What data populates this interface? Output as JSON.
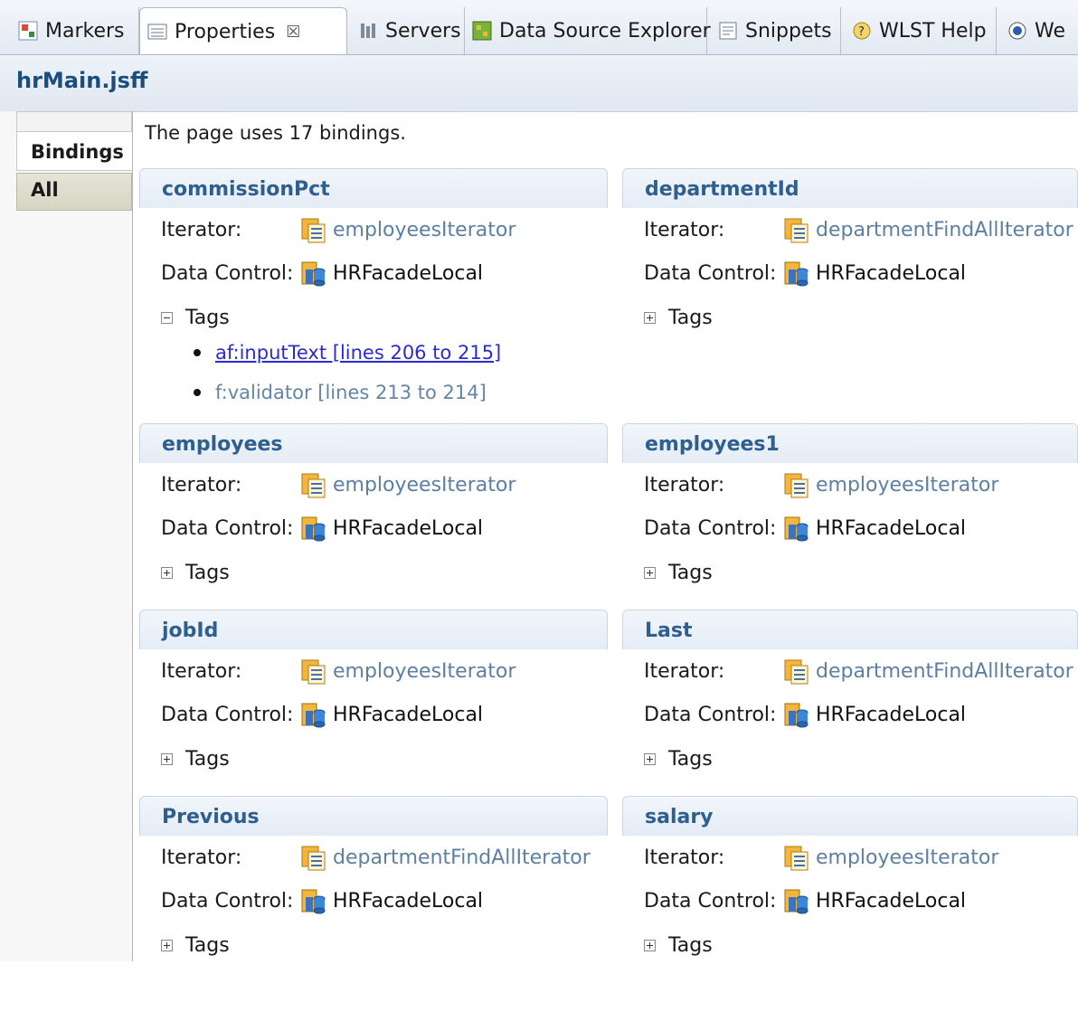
{
  "tabs": [
    {
      "label": "Markers",
      "icon": "markers-icon",
      "active": false
    },
    {
      "label": "Properties",
      "icon": "properties-icon",
      "active": true,
      "close": "☒"
    },
    {
      "label": "Servers",
      "icon": "servers-icon",
      "active": false
    },
    {
      "label": "Data Source Explorer",
      "icon": "data-source-explorer-icon",
      "active": false
    },
    {
      "label": "Snippets",
      "icon": "snippets-icon",
      "active": false
    },
    {
      "label": "WLST Help",
      "icon": "wlst-help-icon",
      "active": false
    },
    {
      "label": "We",
      "icon": "web-icon",
      "active": false
    }
  ],
  "title": "hrMain.jsff",
  "side_tabs": {
    "bindings": "Bindings",
    "all": "All"
  },
  "summary": "The page uses 17 bindings.",
  "labels": {
    "iterator": "Iterator:",
    "data_control": "Data Control:",
    "tags": "Tags"
  },
  "colors": {
    "link": "#5d7fa3",
    "header_text": "#2e5f8f",
    "hyperlink": "#2a2ad6"
  },
  "bindings": [
    {
      "name": "commissionPct",
      "iterator": "employeesIterator",
      "data_control": "HRFacadeLocal",
      "tags_expanded": true,
      "tags": [
        "af:inputText [lines 206 to 215]",
        "f:validator [lines 213 to 214]"
      ]
    },
    {
      "name": "departmentId",
      "iterator": "departmentFindAllIterator",
      "data_control": "HRFacadeLocal",
      "tags_expanded": false
    },
    {
      "name": "employees",
      "iterator": "employeesIterator",
      "data_control": "HRFacadeLocal",
      "tags_expanded": false
    },
    {
      "name": "employees1",
      "iterator": "employeesIterator",
      "data_control": "HRFacadeLocal",
      "tags_expanded": false
    },
    {
      "name": "jobId",
      "iterator": "employeesIterator",
      "data_control": "HRFacadeLocal",
      "tags_expanded": false
    },
    {
      "name": "Last",
      "iterator": "departmentFindAllIterator",
      "data_control": "HRFacadeLocal",
      "tags_expanded": false
    },
    {
      "name": "Previous",
      "iterator": "departmentFindAllIterator",
      "data_control": "HRFacadeLocal",
      "tags_expanded": false
    },
    {
      "name": "salary",
      "iterator": "employeesIterator",
      "data_control": "HRFacadeLocal",
      "tags_expanded": false
    }
  ]
}
